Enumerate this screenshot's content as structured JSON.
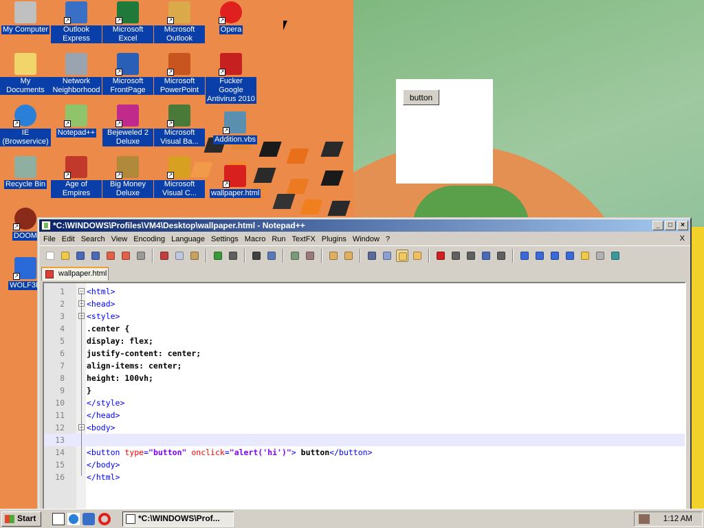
{
  "desktop": {
    "icons": [
      {
        "label": "My Computer",
        "icon": "computer-icon",
        "color": "#c0c0c0"
      },
      {
        "label": "Outlook Express",
        "icon": "outlook-express-icon",
        "color": "#3a6fc6"
      },
      {
        "label": "Microsoft Excel",
        "icon": "excel-icon",
        "color": "#1f7a3a"
      },
      {
        "label": "Microsoft Outlook",
        "icon": "outlook-icon",
        "color": "#d9a94a"
      },
      {
        "label": "Opera",
        "icon": "opera-icon",
        "color": "#e0201e"
      },
      {
        "label": "My Documents",
        "icon": "folder-icon",
        "color": "#f2d56a"
      },
      {
        "label": "Network Neighborhood",
        "icon": "network-icon",
        "color": "#9aa4b0"
      },
      {
        "label": "Microsoft FrontPage",
        "icon": "frontpage-icon",
        "color": "#2a5fb8"
      },
      {
        "label": "Microsoft PowerPoint",
        "icon": "powerpoint-icon",
        "color": "#c8551f"
      },
      {
        "label": "Fucker Google Antivirus 2010",
        "icon": "antivirus-icon",
        "color": "#c62020"
      },
      {
        "label": "IE (Browservice)",
        "icon": "internet-explorer-icon",
        "color": "#2a7fd8"
      },
      {
        "label": "Notepad++",
        "icon": "notepad-plus-plus-icon",
        "color": "#8fc46a"
      },
      {
        "label": "Bejeweled 2 Deluxe",
        "icon": "bejeweled-icon",
        "color": "#c02a8a"
      },
      {
        "label": "Microsoft Visual Ba...",
        "icon": "visual-basic-icon",
        "color": "#4a7a3a"
      },
      {
        "label": "Addition.vbs",
        "icon": "vbs-script-icon",
        "color": "#5a8fb0"
      },
      {
        "label": "Recycle Bin",
        "icon": "recycle-bin-icon",
        "color": "#8fb0a0"
      },
      {
        "label": "Age of Empires",
        "icon": "age-of-empires-icon",
        "color": "#c0392b"
      },
      {
        "label": "Big Money Deluxe",
        "icon": "big-money-icon",
        "color": "#b08a3a"
      },
      {
        "label": "Microsoft Visual C...",
        "icon": "visual-c-icon",
        "color": "#d8a020"
      },
      {
        "label": "wallpaper.html",
        "icon": "html-file-icon",
        "color": "#d8201e"
      },
      {
        "label": "DOOM",
        "icon": "doom-icon",
        "color": "#8a2a1a"
      },
      {
        "label": "WOLF3D",
        "icon": "wolf3d-icon",
        "color": "#2a6ad8"
      }
    ]
  },
  "preview": {
    "button_label": "button"
  },
  "notepad": {
    "title": "*C:\\WINDOWS\\Profiles\\VM4\\Desktop\\wallpaper.html - Notepad++",
    "menu": [
      "File",
      "Edit",
      "Search",
      "View",
      "Encoding",
      "Language",
      "Settings",
      "Macro",
      "Run",
      "TextFX",
      "Plugins",
      "Window",
      "?"
    ],
    "menu_close": "X",
    "tab_label": "wallpaper.html",
    "lines": [
      {
        "n": "1",
        "parts": [
          {
            "t": "<html>",
            "c": "t-tag"
          }
        ]
      },
      {
        "n": "2",
        "parts": [
          {
            "t": "<head>",
            "c": "t-tag"
          }
        ]
      },
      {
        "n": "3",
        "parts": [
          {
            "t": "<style>",
            "c": "t-tag"
          }
        ]
      },
      {
        "n": "4",
        "parts": [
          {
            "t": ".center {",
            "c": "t-text"
          }
        ]
      },
      {
        "n": "5",
        "parts": [
          {
            "t": "display: flex;",
            "c": "t-text"
          }
        ]
      },
      {
        "n": "6",
        "parts": [
          {
            "t": "justify-content: center;",
            "c": "t-text"
          }
        ]
      },
      {
        "n": "7",
        "parts": [
          {
            "t": "align-items: center;",
            "c": "t-text"
          }
        ]
      },
      {
        "n": "8",
        "parts": [
          {
            "t": "height: 100vh;",
            "c": "t-text"
          }
        ]
      },
      {
        "n": "9",
        "parts": [
          {
            "t": "}",
            "c": "t-text"
          }
        ]
      },
      {
        "n": "10",
        "parts": [
          {
            "t": "</style>",
            "c": "t-tag"
          }
        ]
      },
      {
        "n": "11",
        "parts": [
          {
            "t": "</head>",
            "c": "t-tag"
          }
        ]
      },
      {
        "n": "12",
        "parts": [
          {
            "t": "<body>",
            "c": "t-tag"
          }
        ]
      },
      {
        "n": "13",
        "parts": []
      },
      {
        "n": "14",
        "parts": [
          {
            "t": "<button ",
            "c": "t-tag"
          },
          {
            "t": "type",
            "c": "t-attr"
          },
          {
            "t": "=",
            "c": "t-tag"
          },
          {
            "t": "\"button\"",
            "c": "t-val"
          },
          {
            "t": " ",
            "c": "t-tag"
          },
          {
            "t": "onclick",
            "c": "t-attr"
          },
          {
            "t": "=",
            "c": "t-tag"
          },
          {
            "t": "\"alert('hi')\"",
            "c": "t-val"
          },
          {
            "t": ">",
            "c": "t-tag"
          },
          {
            "t": " button",
            "c": "t-text"
          },
          {
            "t": "</button>",
            "c": "t-tag"
          }
        ]
      },
      {
        "n": "15",
        "parts": [
          {
            "t": "</body>",
            "c": "t-tag"
          }
        ]
      },
      {
        "n": "16",
        "parts": [
          {
            "t": "</html>",
            "c": "t-tag"
          }
        ]
      }
    ],
    "current_line": "13"
  },
  "taskbar": {
    "start_label": "Start",
    "task_label": "*C:\\WINDOWS\\Prof...",
    "clock": "1:12 AM"
  }
}
